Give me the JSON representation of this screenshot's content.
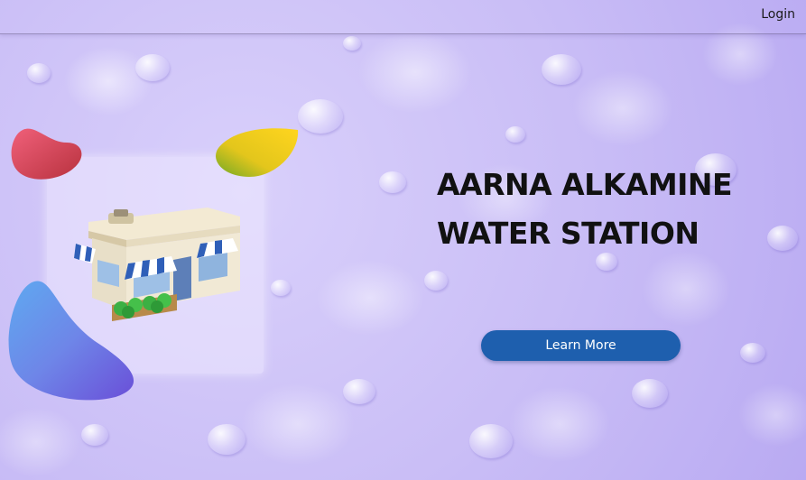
{
  "header": {
    "login_label": "Login"
  },
  "hero": {
    "title_line1": "AARNA ALKAMINE",
    "title_line2": "WATER STATION",
    "cta_label": "Learn More"
  },
  "colors": {
    "background": "#cfc3f7",
    "cta_button": "#1e5fae",
    "blob_red": "#d9475e",
    "blob_yellow": "#f2cf1c",
    "blob_blue": "#7a83e6"
  },
  "icons": {
    "store_illustration": "shop-storefront-illustration"
  }
}
